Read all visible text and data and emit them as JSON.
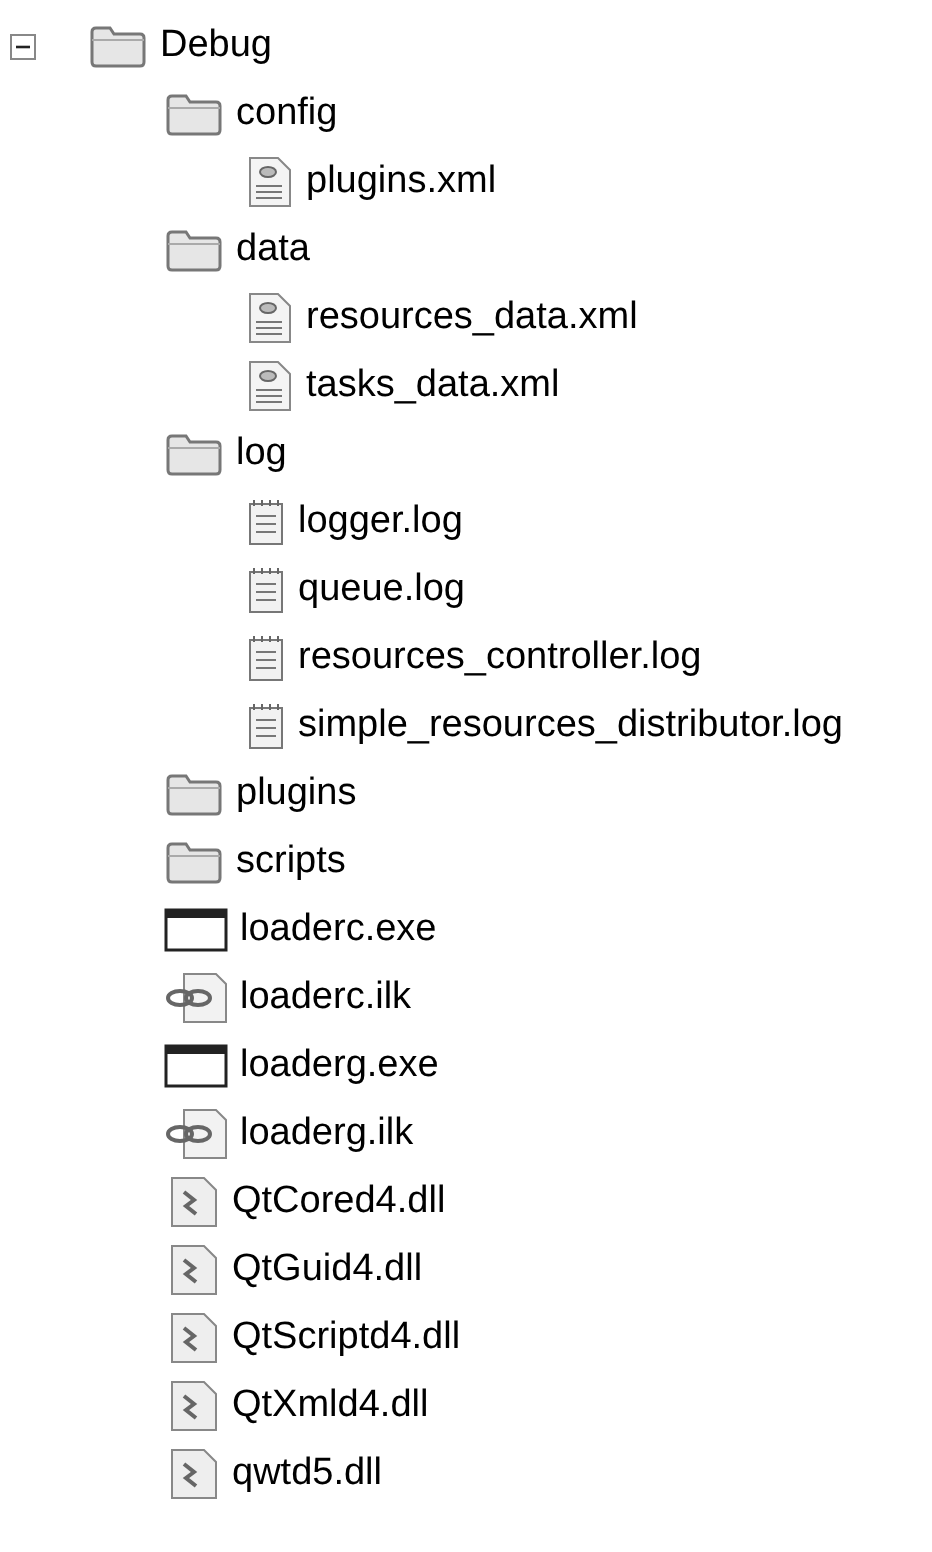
{
  "tree": {
    "label": "Debug",
    "kind": "folder",
    "expanded": true,
    "children": [
      {
        "label": "config",
        "kind": "folder",
        "children": [
          {
            "label": "plugins.xml",
            "kind": "xml"
          }
        ]
      },
      {
        "label": "data",
        "kind": "folder",
        "children": [
          {
            "label": "resources_data.xml",
            "kind": "xml"
          },
          {
            "label": "tasks_data.xml",
            "kind": "xml"
          }
        ]
      },
      {
        "label": "log",
        "kind": "folder",
        "children": [
          {
            "label": "logger.log",
            "kind": "log"
          },
          {
            "label": "queue.log",
            "kind": "log"
          },
          {
            "label": "resources_controller.log",
            "kind": "log"
          },
          {
            "label": "simple_resources_distributor.log",
            "kind": "log"
          }
        ]
      },
      {
        "label": "plugins",
        "kind": "folder"
      },
      {
        "label": "scripts",
        "kind": "folder"
      },
      {
        "label": "loaderc.exe",
        "kind": "exe"
      },
      {
        "label": "loaderc.ilk",
        "kind": "ilk"
      },
      {
        "label": "loaderg.exe",
        "kind": "exe"
      },
      {
        "label": "loaderg.ilk",
        "kind": "ilk"
      },
      {
        "label": "QtCored4.dll",
        "kind": "dll"
      },
      {
        "label": "QtGuid4.dll",
        "kind": "dll"
      },
      {
        "label": "QtScriptd4.dll",
        "kind": "dll"
      },
      {
        "label": "QtXmld4.dll",
        "kind": "dll"
      },
      {
        "label": "qwtd5.dll",
        "kind": "dll"
      }
    ]
  }
}
